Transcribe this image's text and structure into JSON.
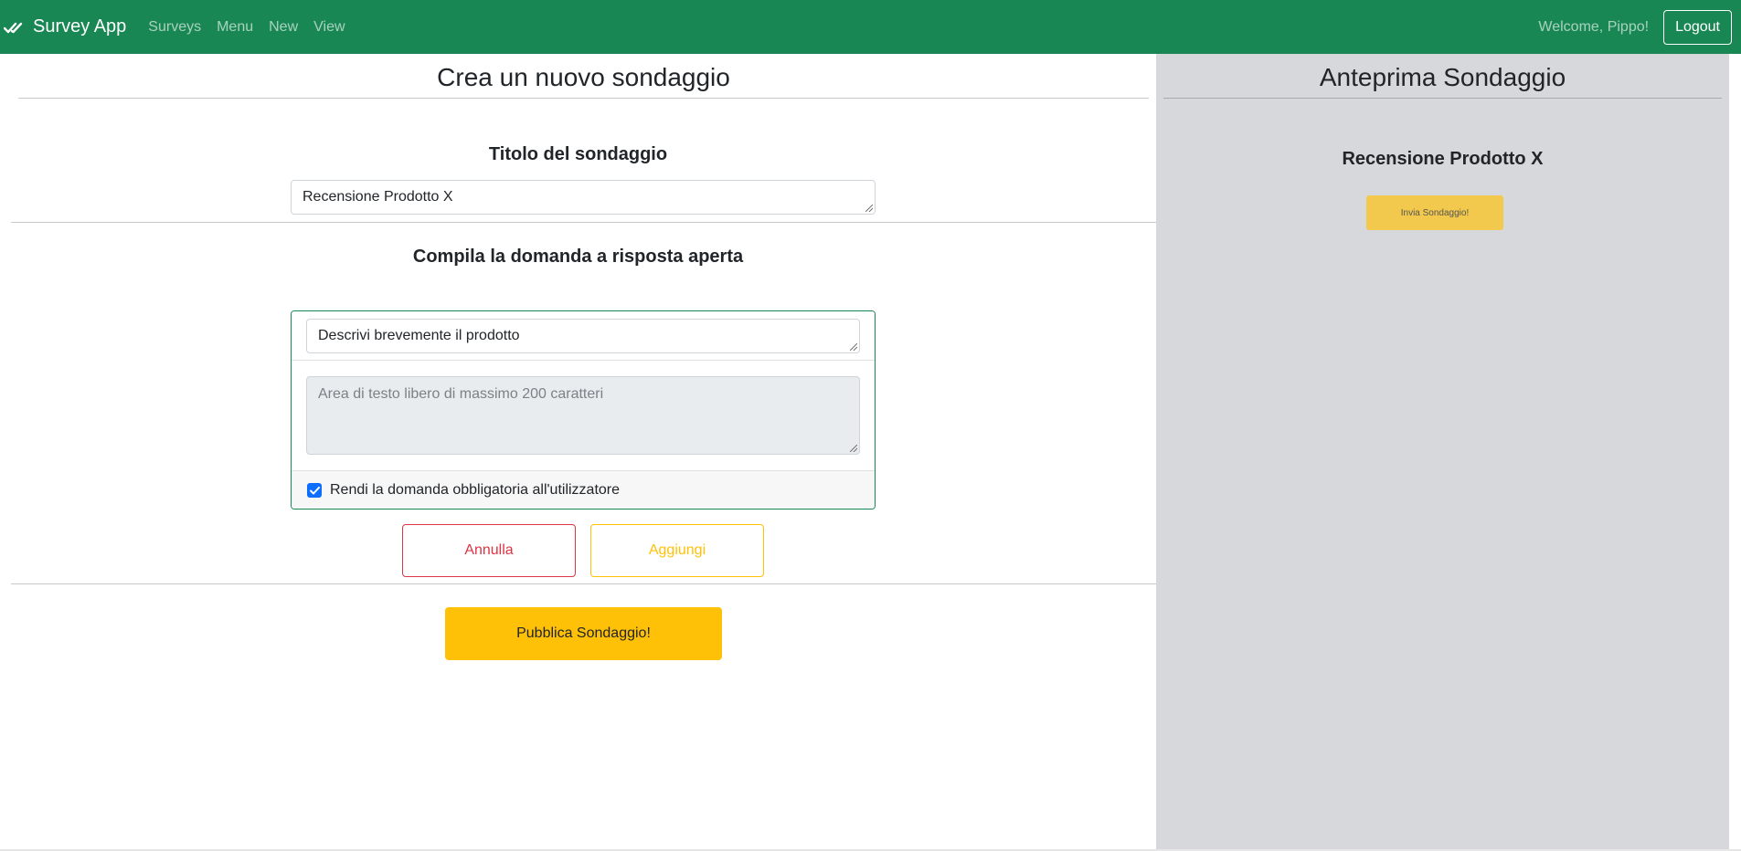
{
  "navbar": {
    "brand_label": "Survey App",
    "brand_icon": "double-check-icon",
    "links": [
      "Surveys",
      "Menu",
      "New",
      "View"
    ],
    "welcome_text": "Welcome, Pippo!",
    "logout_label": "Logout",
    "color": "#198754"
  },
  "editor": {
    "page_title": "Crea un nuovo sondaggio",
    "title_section_heading": "Titolo del sondaggio",
    "survey_title_value": "Recensione Prodotto X",
    "question_section_heading": "Compila la domanda a risposta aperta",
    "question": {
      "text_value": "Descrivi brevemente il prodotto",
      "answer_placeholder": "Area di testo libero di massimo 200 caratteri",
      "mandatory_label": "Rendi la domanda obbligatoria all'utilizzatore",
      "mandatory_checked": true
    },
    "cancel_label": "Annulla",
    "add_label": "Aggiungi",
    "publish_label": "Pubblica Sondaggio!"
  },
  "preview": {
    "title": "Anteprima Sondaggio",
    "survey_title": "Recensione Prodotto X",
    "send_label": "Invia Sondaggio!"
  }
}
